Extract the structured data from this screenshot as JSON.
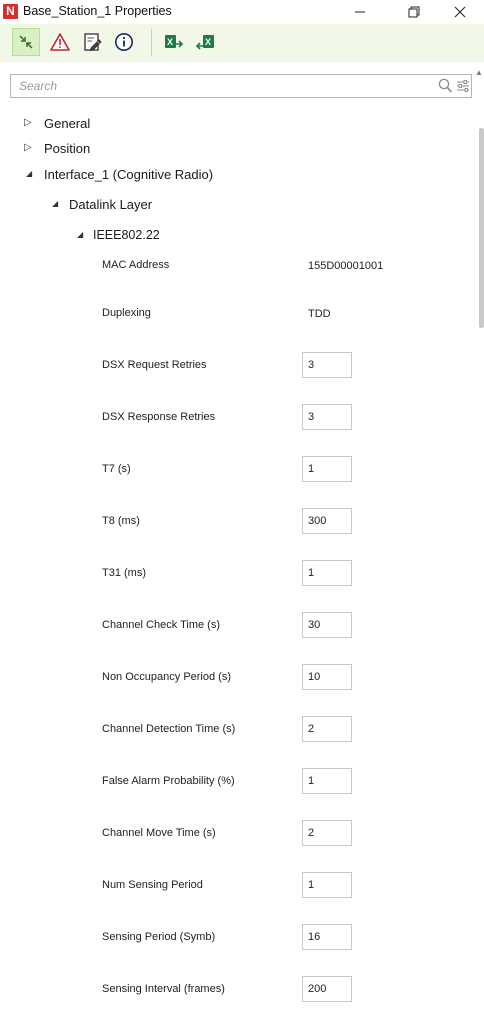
{
  "window": {
    "title": "Base_Station_1 Properties",
    "logo_text": "N",
    "controls": {
      "minimize": "—",
      "maximize": "❐",
      "close": "✕"
    }
  },
  "toolbar": {
    "buttons": [
      {
        "icon": "collapse-arrows-icon"
      },
      {
        "icon": "warning-icon"
      },
      {
        "icon": "edit-document-icon"
      },
      {
        "icon": "info-icon"
      },
      {
        "icon": "excel-export-icon"
      },
      {
        "icon": "excel-import-icon"
      }
    ]
  },
  "search": {
    "placeholder": "Search"
  },
  "tree": {
    "general": {
      "label": "General",
      "arrow": "▷"
    },
    "position": {
      "label": "Position",
      "arrow": "▷"
    },
    "interface": {
      "label": "Interface_1 (Cognitive Radio)",
      "arrow": "◢"
    },
    "datalink": {
      "label": "Datalink Layer",
      "arrow": "◢"
    },
    "protocol": {
      "label": "IEEE802.22",
      "arrow": "◢"
    }
  },
  "properties": {
    "mac_address": {
      "label": "MAC Address",
      "value": "155D00001001"
    },
    "duplexing": {
      "label": "Duplexing",
      "value": "TDD"
    },
    "dsx_request_retries": {
      "label": "DSX Request Retries",
      "value": "3"
    },
    "dsx_response_retries": {
      "label": "DSX Response Retries",
      "value": "3"
    },
    "t7": {
      "label": "T7 (s)",
      "value": "1"
    },
    "t8": {
      "label": "T8 (ms)",
      "value": "300"
    },
    "t31": {
      "label": "T31 (ms)",
      "value": "1"
    },
    "channel_check_time": {
      "label": "Channel Check Time (s)",
      "value": "30"
    },
    "non_occupancy_period": {
      "label": "Non Occupancy Period (s)",
      "value": "10"
    },
    "channel_detection_time": {
      "label": "Channel Detection Time (s)",
      "value": "2"
    },
    "false_alarm_probability": {
      "label": "False Alarm Probability (%)",
      "value": "1"
    },
    "channel_move_time": {
      "label": "Channel Move Time (s)",
      "value": "2"
    },
    "num_sensing_period": {
      "label": "Num Sensing Period",
      "value": "1"
    },
    "sensing_period": {
      "label": "Sensing Period (Symb)",
      "value": "16"
    },
    "sensing_interval": {
      "label": "Sensing Interval (frames)",
      "value": "200"
    }
  },
  "colors": {
    "toolbar_bg": "#f1f8e8",
    "logo_red": "#d32f2f",
    "excel_green": "#1e7b45"
  }
}
